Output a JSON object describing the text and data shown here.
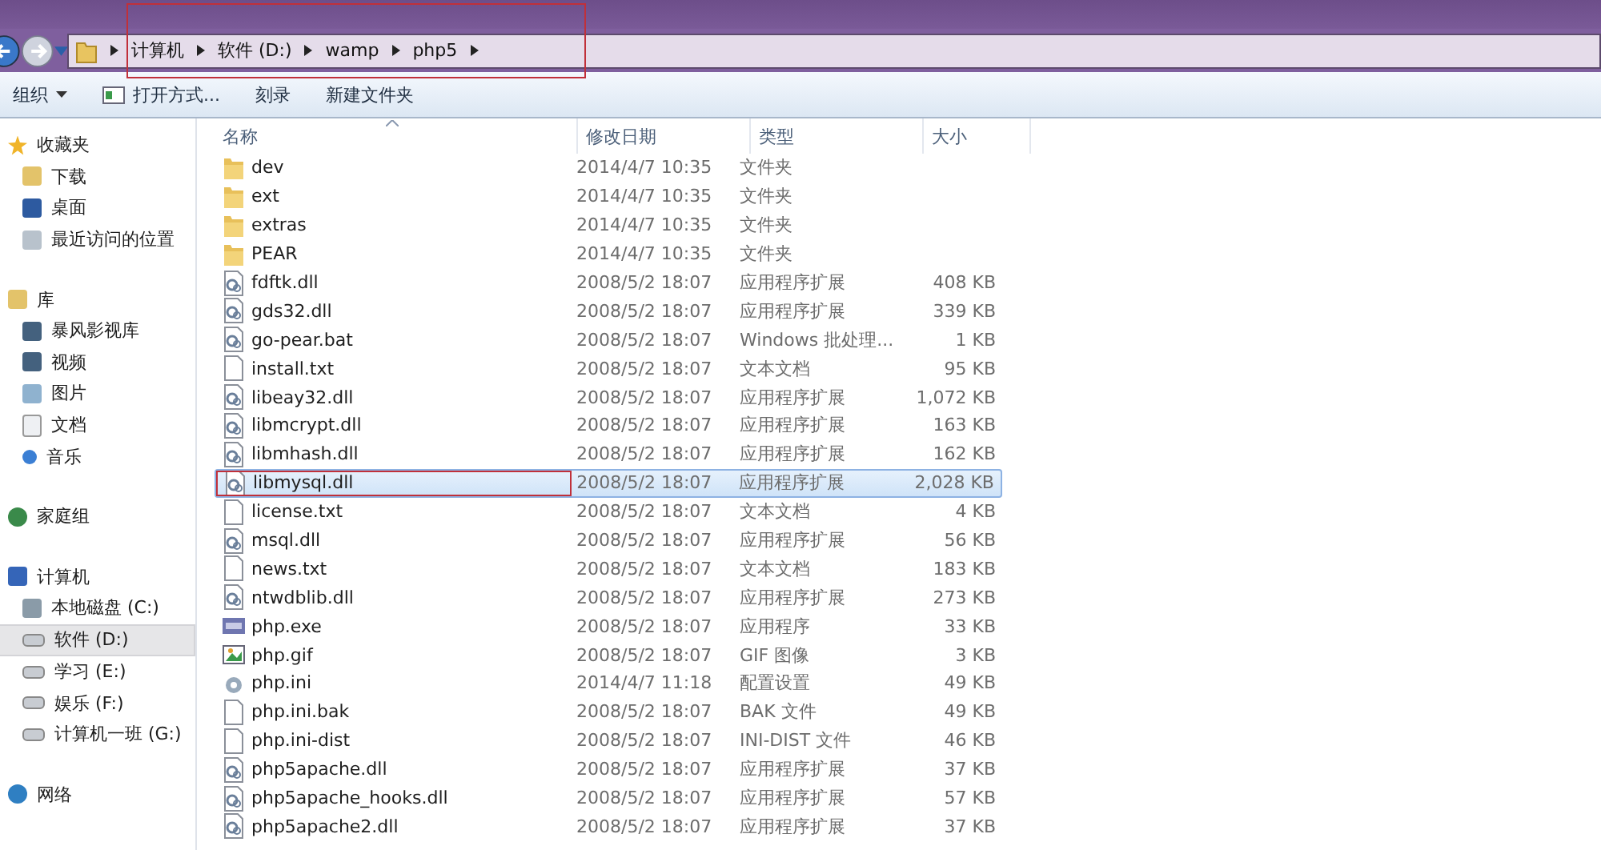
{
  "address_bar": {
    "highlighted": true,
    "crumbs": [
      "计算机",
      "软件 (D:)",
      "wamp",
      "php5"
    ]
  },
  "toolbar": {
    "organize": "组织",
    "buttons": [
      {
        "label": "打开方式...",
        "kind": "open"
      },
      {
        "label": "刻录",
        "kind": "plain"
      },
      {
        "label": "新建文件夹",
        "kind": "plain"
      }
    ]
  },
  "sidebar": {
    "groups": [
      {
        "label": "收藏夹",
        "items": [
          {
            "label": "下载",
            "selected": false
          },
          {
            "label": "桌面",
            "selected": false
          },
          {
            "label": "最近访问的位置",
            "selected": false
          }
        ]
      },
      {
        "label": "库",
        "items": [
          {
            "label": "暴风影视库",
            "selected": false
          },
          {
            "label": "视频",
            "selected": false
          },
          {
            "label": "图片",
            "selected": false
          },
          {
            "label": "文档",
            "selected": false
          },
          {
            "label": "音乐",
            "selected": false
          }
        ]
      },
      {
        "label": "家庭组"
      },
      {
        "label": "计算机",
        "items": [
          {
            "label": "本地磁盘 (C:)",
            "selected": false
          },
          {
            "label": "软件 (D:)",
            "selected": true
          },
          {
            "label": "学习  (E:)",
            "selected": false
          },
          {
            "label": "娱乐 (F:)",
            "selected": false
          },
          {
            "label": "计算机一班 (G:)",
            "selected": false
          }
        ]
      },
      {
        "label": "网络"
      }
    ]
  },
  "table": {
    "columns": [
      "名称",
      "修改日期",
      "类型",
      "大小"
    ],
    "rows": [
      {
        "name": "dev",
        "date": "2014/4/7 10:35",
        "type": "文件夹",
        "kind": "folder",
        "selected": false,
        "highlighted": false
      },
      {
        "name": "ext",
        "date": "2014/4/7 10:35",
        "type": "文件夹",
        "kind": "folder",
        "selected": false,
        "highlighted": false
      },
      {
        "name": "extras",
        "date": "2014/4/7 10:35",
        "type": "文件夹",
        "kind": "folder",
        "selected": false,
        "highlighted": false
      },
      {
        "name": "PEAR",
        "date": "2014/4/7 10:35",
        "type": "文件夹",
        "kind": "folder",
        "selected": false,
        "highlighted": false
      },
      {
        "name": "fdftk.dll",
        "date": "2008/5/2 18:07",
        "type": "应用程序扩展",
        "size": "408 KB",
        "kind": "dll",
        "selected": false,
        "highlighted": false
      },
      {
        "name": "gds32.dll",
        "date": "2008/5/2 18:07",
        "type": "应用程序扩展",
        "size": "339 KB",
        "kind": "dll",
        "selected": false,
        "highlighted": false
      },
      {
        "name": "go-pear.bat",
        "date": "2008/5/2 18:07",
        "type": "Windows 批处理...",
        "size": "1 KB",
        "kind": "bat",
        "selected": false,
        "highlighted": false
      },
      {
        "name": "install.txt",
        "date": "2008/5/2 18:07",
        "type": "文本文档",
        "size": "95 KB",
        "kind": "txt",
        "selected": false,
        "highlighted": false
      },
      {
        "name": "libeay32.dll",
        "date": "2008/5/2 18:07",
        "type": "应用程序扩展",
        "size": "1,072 KB",
        "kind": "dll",
        "selected": false,
        "highlighted": false
      },
      {
        "name": "libmcrypt.dll",
        "date": "2008/5/2 18:07",
        "type": "应用程序扩展",
        "size": "163 KB",
        "kind": "dll",
        "selected": false,
        "highlighted": false
      },
      {
        "name": "libmhash.dll",
        "date": "2008/5/2 18:07",
        "type": "应用程序扩展",
        "size": "162 KB",
        "kind": "dll",
        "selected": false,
        "highlighted": false
      },
      {
        "name": "libmysql.dll",
        "date": "2008/5/2 18:07",
        "type": "应用程序扩展",
        "size": "2,028 KB",
        "kind": "dll",
        "selected": true,
        "highlighted": true
      },
      {
        "name": "license.txt",
        "date": "2008/5/2 18:07",
        "type": "文本文档",
        "size": "4 KB",
        "kind": "txt",
        "selected": false,
        "highlighted": false
      },
      {
        "name": "msql.dll",
        "date": "2008/5/2 18:07",
        "type": "应用程序扩展",
        "size": "56 KB",
        "kind": "dll",
        "selected": false,
        "highlighted": false
      },
      {
        "name": "news.txt",
        "date": "2008/5/2 18:07",
        "type": "文本文档",
        "size": "183 KB",
        "kind": "txt",
        "selected": false,
        "highlighted": false
      },
      {
        "name": "ntwdblib.dll",
        "date": "2008/5/2 18:07",
        "type": "应用程序扩展",
        "size": "273 KB",
        "kind": "dll",
        "selected": false,
        "highlighted": false
      },
      {
        "name": "php.exe",
        "date": "2008/5/2 18:07",
        "type": "应用程序",
        "size": "33 KB",
        "kind": "exe",
        "selected": false,
        "highlighted": false
      },
      {
        "name": "php.gif",
        "date": "2008/5/2 18:07",
        "type": "GIF 图像",
        "size": "3 KB",
        "kind": "gif",
        "selected": false,
        "highlighted": false
      },
      {
        "name": "php.ini",
        "date": "2014/4/7 11:18",
        "type": "配置设置",
        "size": "49 KB",
        "kind": "ini",
        "selected": false,
        "highlighted": false
      },
      {
        "name": "php.ini.bak",
        "date": "2008/5/2 18:07",
        "type": "BAK 文件",
        "size": "49 KB",
        "kind": "file",
        "selected": false,
        "highlighted": false
      },
      {
        "name": "php.ini-dist",
        "date": "2008/5/2 18:07",
        "type": "INI-DIST 文件",
        "size": "46 KB",
        "kind": "file",
        "selected": false,
        "highlighted": false
      },
      {
        "name": "php5apache.dll",
        "date": "2008/5/2 18:07",
        "type": "应用程序扩展",
        "size": "37 KB",
        "kind": "dll",
        "selected": false,
        "highlighted": false
      },
      {
        "name": "php5apache_hooks.dll",
        "date": "2008/5/2 18:07",
        "type": "应用程序扩展",
        "size": "57 KB",
        "kind": "dll",
        "selected": false,
        "highlighted": false
      },
      {
        "name": "php5apache2.dll",
        "date": "2008/5/2 18:07",
        "type": "应用程序扩展",
        "size": "37 KB",
        "kind": "dll",
        "selected": false,
        "highlighted": false
      }
    ]
  }
}
